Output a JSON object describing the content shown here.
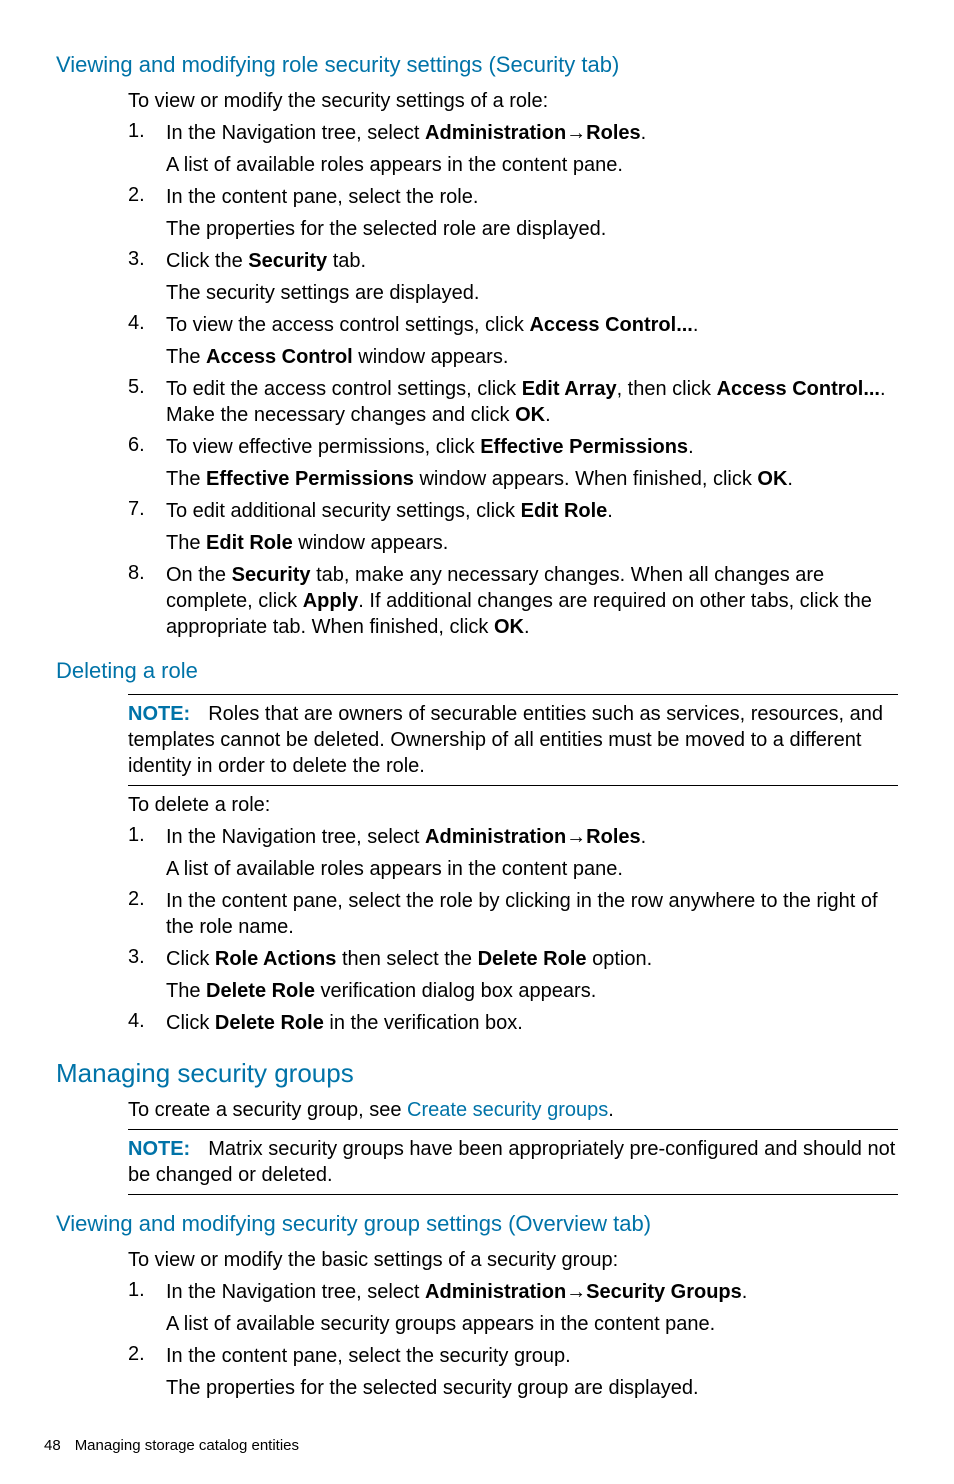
{
  "sec1": {
    "heading": "Viewing and modifying role security settings (Security tab)",
    "intro": "To view or modify the security settings of a role:",
    "steps": [
      {
        "n": "1.",
        "l1a": "In the Navigation tree, select ",
        "l1b": "Administration",
        "arrow": "→",
        "l1c": "Roles",
        "l1d": ".",
        "l2": "A list of available roles appears in the content pane."
      },
      {
        "n": "2.",
        "l1": "In the content pane, select the role.",
        "l2": "The properties for the selected role are displayed."
      },
      {
        "n": "3.",
        "l1a": "Click the ",
        "l1b": "Security",
        "l1c": " tab.",
        "l2": "The security settings are displayed."
      },
      {
        "n": "4.",
        "l1a": "To view the access control settings, click ",
        "l1b": "Access Control...",
        "l1c": ".",
        "l2a": "The ",
        "l2b": "Access Control",
        "l2c": " window appears."
      },
      {
        "n": "5.",
        "l1a": "To edit the access control settings, click ",
        "l1b": "Edit Array",
        "l1c": ", then click ",
        "l1d": "Access Control...",
        "l1e": ". Make the necessary changes and click ",
        "l1f": "OK",
        "l1g": "."
      },
      {
        "n": "6.",
        "l1a": "To view effective permissions, click ",
        "l1b": "Effective Permissions",
        "l1c": ".",
        "l2a": "The ",
        "l2b": "Effective Permissions",
        "l2c": " window appears. When finished, click ",
        "l2d": "OK",
        "l2e": "."
      },
      {
        "n": "7.",
        "l1a": "To edit additional security settings, click ",
        "l1b": "Edit Role",
        "l1c": ".",
        "l2a": "The ",
        "l2b": "Edit Role",
        "l2c": " window appears."
      },
      {
        "n": "8.",
        "l1a": "On the ",
        "l1b": "Security",
        "l1c": " tab, make any necessary changes. When all changes are complete, click ",
        "l1d": "Apply",
        "l1e": ". If additional changes are required on other tabs, click the appropriate tab. When finished, click ",
        "l1f": "OK",
        "l1g": "."
      }
    ]
  },
  "sec2": {
    "heading": "Deleting a role",
    "noteLabel": "NOTE:",
    "noteBody": "Roles that are owners of securable entities such as services, resources, and templates cannot be deleted. Ownership of all entities must be moved to a different identity in order to delete the role.",
    "intro": "To delete a role:",
    "steps": [
      {
        "n": "1.",
        "l1a": "In the Navigation tree, select ",
        "l1b": "Administration",
        "arrow": "→",
        "l1c": "Roles",
        "l1d": ".",
        "l2": "A list of available roles appears in the content pane."
      },
      {
        "n": "2.",
        "l1": "In the content pane, select the role by clicking in the row anywhere to the right of the role name."
      },
      {
        "n": "3.",
        "l1a": "Click ",
        "l1b": "Role Actions",
        "l1c": " then select the ",
        "l1d": "Delete Role",
        "l1e": " option.",
        "l2a": "The ",
        "l2b": "Delete Role",
        "l2c": " verification dialog box appears."
      },
      {
        "n": "4.",
        "l1a": "Click ",
        "l1b": "Delete Role",
        "l1c": " in the verification box."
      }
    ]
  },
  "sec3": {
    "heading": "Managing security groups",
    "introA": "To create a security group, see ",
    "link": "Create security groups",
    "introB": ".",
    "noteLabel": "NOTE:",
    "noteBody": "Matrix security groups have been appropriately pre-configured and should not be changed or deleted."
  },
  "sec4": {
    "heading": "Viewing and modifying security group settings (Overview tab)",
    "intro": "To view or modify the basic settings of a security group:",
    "steps": [
      {
        "n": "1.",
        "l1a": "In the Navigation tree, select ",
        "l1b": "Administration",
        "arrow": "→",
        "l1c": "Security Groups",
        "l1d": ".",
        "l2": "A list of available security groups appears in the content pane."
      },
      {
        "n": "2.",
        "l1": "In the content pane, select the security group.",
        "l2": "The properties for the selected security group are displayed."
      }
    ]
  },
  "footer": {
    "page": "48",
    "chapter": "Managing storage catalog entities"
  }
}
